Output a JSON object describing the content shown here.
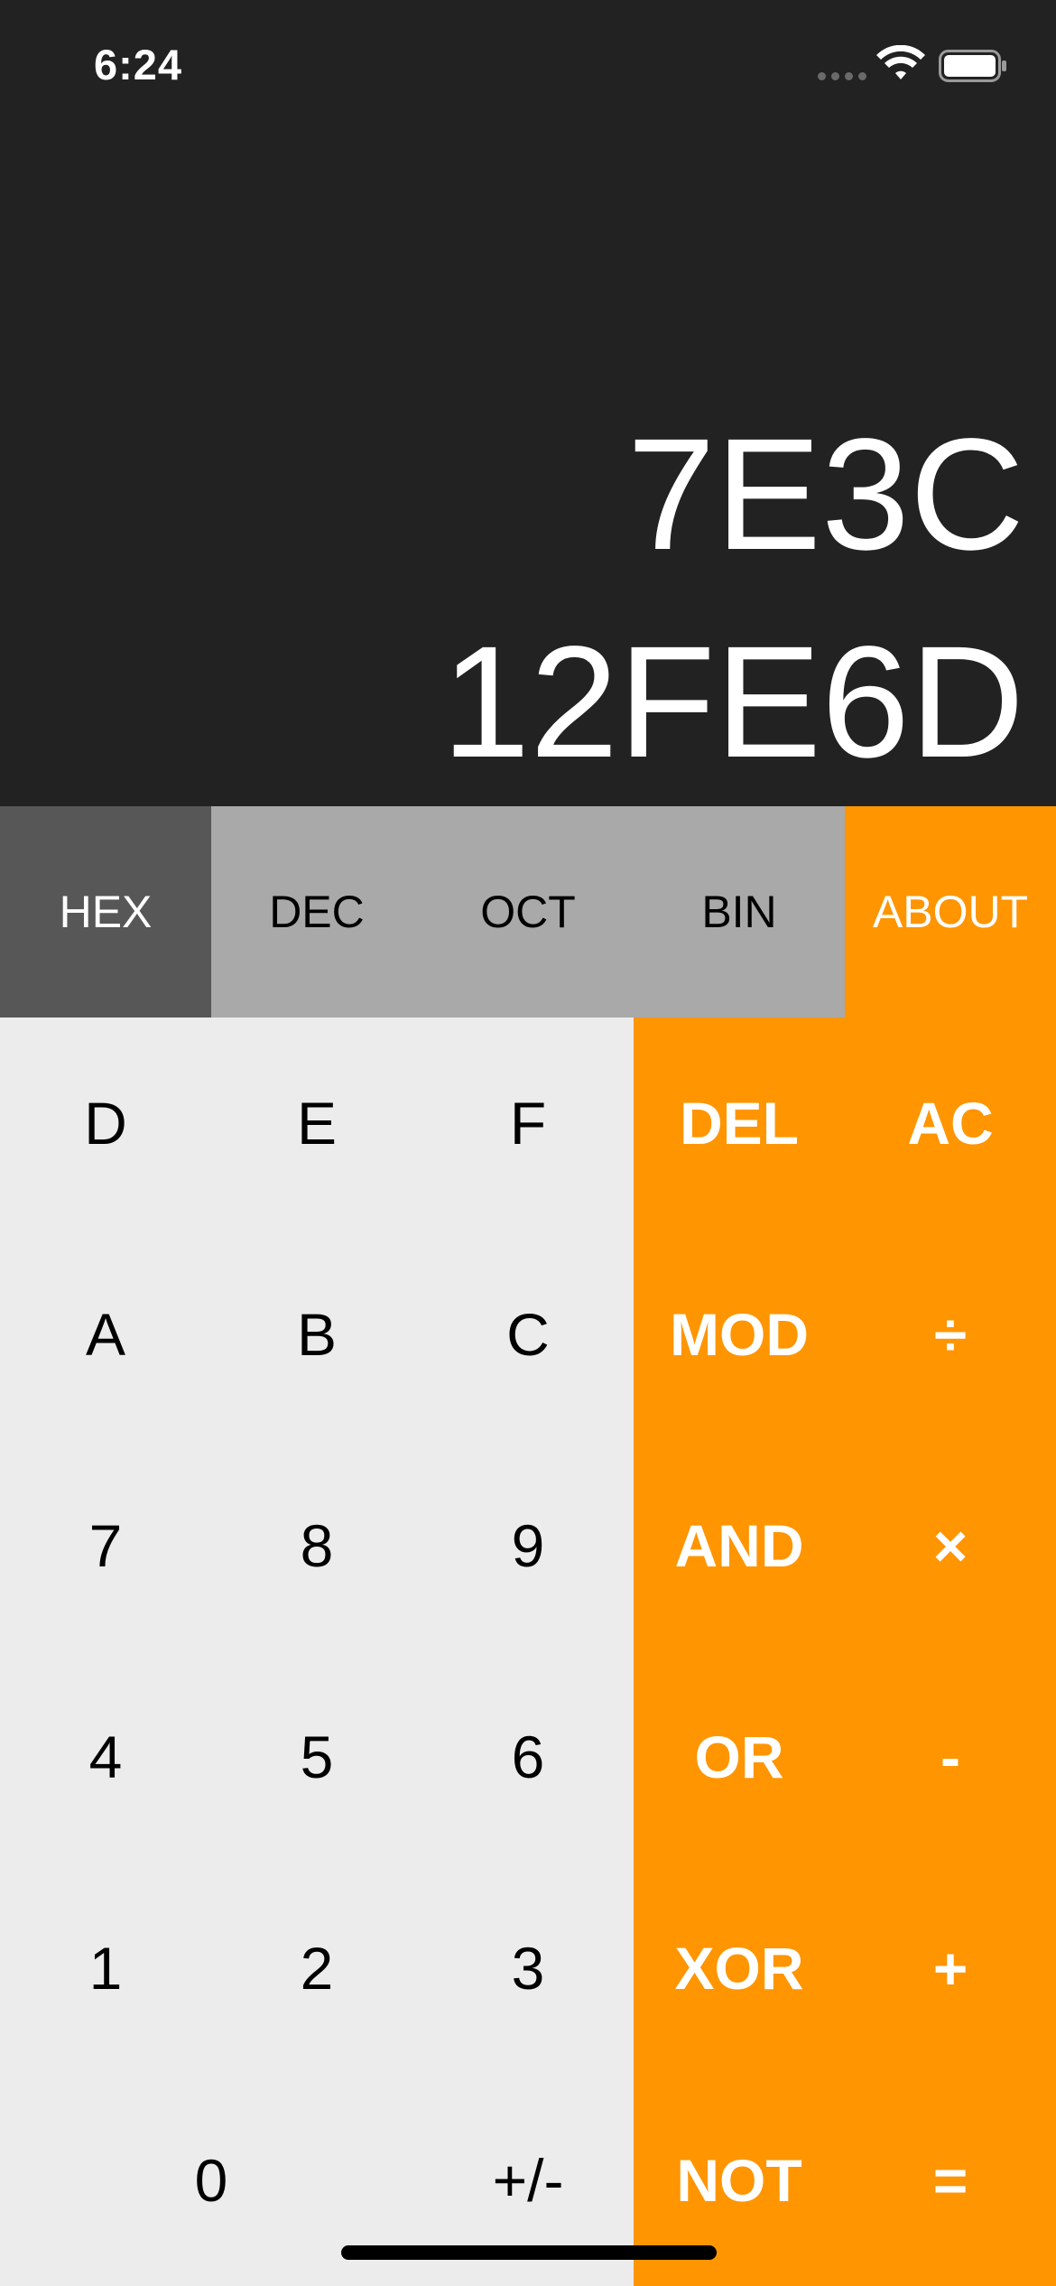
{
  "status_bar": {
    "time": "6:24",
    "icons": [
      "signal-dots-icon",
      "wifi-icon",
      "battery-icon"
    ]
  },
  "display": {
    "line1": "7E3C",
    "line2": "12FE6D"
  },
  "base_selector": {
    "selected": "HEX",
    "items": [
      {
        "label": "HEX"
      },
      {
        "label": "DEC"
      },
      {
        "label": "OCT"
      },
      {
        "label": "BIN"
      },
      {
        "label": "ABOUT"
      }
    ]
  },
  "keypad": {
    "row1": [
      "D",
      "E",
      "F",
      "DEL",
      "AC"
    ],
    "row2": [
      "A",
      "B",
      "C",
      "MOD",
      "÷"
    ],
    "row3": [
      "7",
      "8",
      "9",
      "AND",
      "×"
    ],
    "row4": [
      "4",
      "5",
      "6",
      "OR",
      "-"
    ],
    "row5": [
      "1",
      "2",
      "3",
      "XOR",
      "+"
    ],
    "row6": [
      "0",
      "+/-",
      "NOT",
      "="
    ]
  },
  "colors": {
    "background": "#222222",
    "accent": "#ff9500",
    "digit_key": "#ececec",
    "base_key": "#a9a9a9",
    "base_selected": "#575757"
  }
}
